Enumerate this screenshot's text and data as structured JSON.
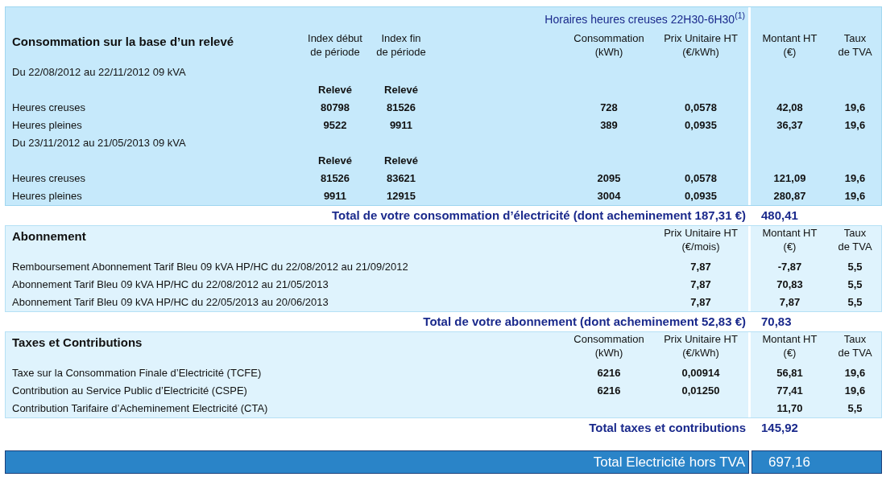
{
  "consumption": {
    "schedule_note": "Horaires heures creuses 22H30-6H30$^{(1)}$",
    "title": "Consommation sur la base d’un relevé",
    "headers": {
      "start": [
        "Index début",
        "de période"
      ],
      "end": [
        "Index fin",
        "de période"
      ],
      "consumption": [
        "Consommation",
        "(kWh)"
      ],
      "unit_price": [
        "Prix Unitaire HT",
        "(€/kWh)"
      ],
      "amount": [
        "Montant HT",
        "(€)"
      ],
      "vat": [
        "Taux",
        "de TVA"
      ]
    },
    "periods": [
      {
        "label": "Du 22/08/2012 au 22/11/2012 09 kVA",
        "reading_labels": [
          "Relevé",
          "Relevé"
        ],
        "rows": [
          {
            "label": "Heures creuses",
            "start": "80798",
            "end": "81526",
            "consumption": "728",
            "unit_price": "0,0578",
            "amount": "42,08",
            "vat": "19,6"
          },
          {
            "label": "Heures pleines",
            "start": "9522",
            "end": "9911",
            "consumption": "389",
            "unit_price": "0,0935",
            "amount": "36,37",
            "vat": "19,6"
          }
        ]
      },
      {
        "label": "Du 23/11/2012 au 21/05/2013 09 kVA",
        "reading_labels": [
          "Relevé",
          "Relevé"
        ],
        "rows": [
          {
            "label": "Heures creuses",
            "start": "81526",
            "end": "83621",
            "consumption": "2095",
            "unit_price": "0,0578",
            "amount": "121,09",
            "vat": "19,6"
          },
          {
            "label": "Heures pleines",
            "start": "9911",
            "end": "12915",
            "consumption": "3004",
            "unit_price": "0,0935",
            "amount": "280,87",
            "vat": "19,6"
          }
        ]
      }
    ],
    "total": {
      "label": "Total de votre consommation d’électricité (dont acheminement 187,31 €)",
      "amount": "480,41"
    }
  },
  "subscription": {
    "title": "Abonnement",
    "headers": {
      "unit_price": [
        "Prix Unitaire HT",
        "(€/mois)"
      ],
      "amount": [
        "Montant HT",
        "(€)"
      ],
      "vat": [
        "Taux",
        "de TVA"
      ]
    },
    "rows": [
      {
        "label": "Remboursement Abonnement Tarif Bleu 09 kVA HP/HC du 22/08/2012 au 21/09/2012",
        "unit_price": "7,87",
        "amount": "-7,87",
        "vat": "5,5"
      },
      {
        "label": "Abonnement Tarif Bleu 09 kVA HP/HC du 22/08/2012 au 21/05/2013",
        "unit_price": "7,87",
        "amount": "70,83",
        "vat": "5,5"
      },
      {
        "label": "Abonnement Tarif Bleu 09 kVA HP/HC du 22/05/2013 au 20/06/2013",
        "unit_price": "7,87",
        "amount": "7,87",
        "vat": "5,5"
      }
    ],
    "total": {
      "label": "Total de votre abonnement (dont acheminement 52,83 €)",
      "amount": "70,83"
    }
  },
  "taxes": {
    "title": "Taxes et Contributions",
    "headers": {
      "consumption": [
        "Consommation",
        "(kWh)"
      ],
      "unit_price": [
        "Prix Unitaire HT",
        "(€/kWh)"
      ],
      "amount": [
        "Montant HT",
        "(€)"
      ],
      "vat": [
        "Taux",
        "de TVA"
      ]
    },
    "rows": [
      {
        "label": "Taxe sur la Consommation Finale d’Electricité (TCFE)",
        "consumption": "6216",
        "unit_price": "0,00914",
        "amount": "56,81",
        "vat": "19,6"
      },
      {
        "label": "Contribution au Service Public d’Electricité (CSPE)",
        "consumption": "6216",
        "unit_price": "0,01250",
        "amount": "77,41",
        "vat": "19,6"
      },
      {
        "label": "Contribution Tarifaire d’Acheminement Electricité (CTA)",
        "amount": "11,70",
        "vat": "5,5"
      }
    ],
    "total": {
      "label": "Total taxes et contributions",
      "amount": "145,92"
    }
  },
  "grand_total": {
    "label": "Total Electricité hors TVA",
    "amount": "697,16"
  }
}
